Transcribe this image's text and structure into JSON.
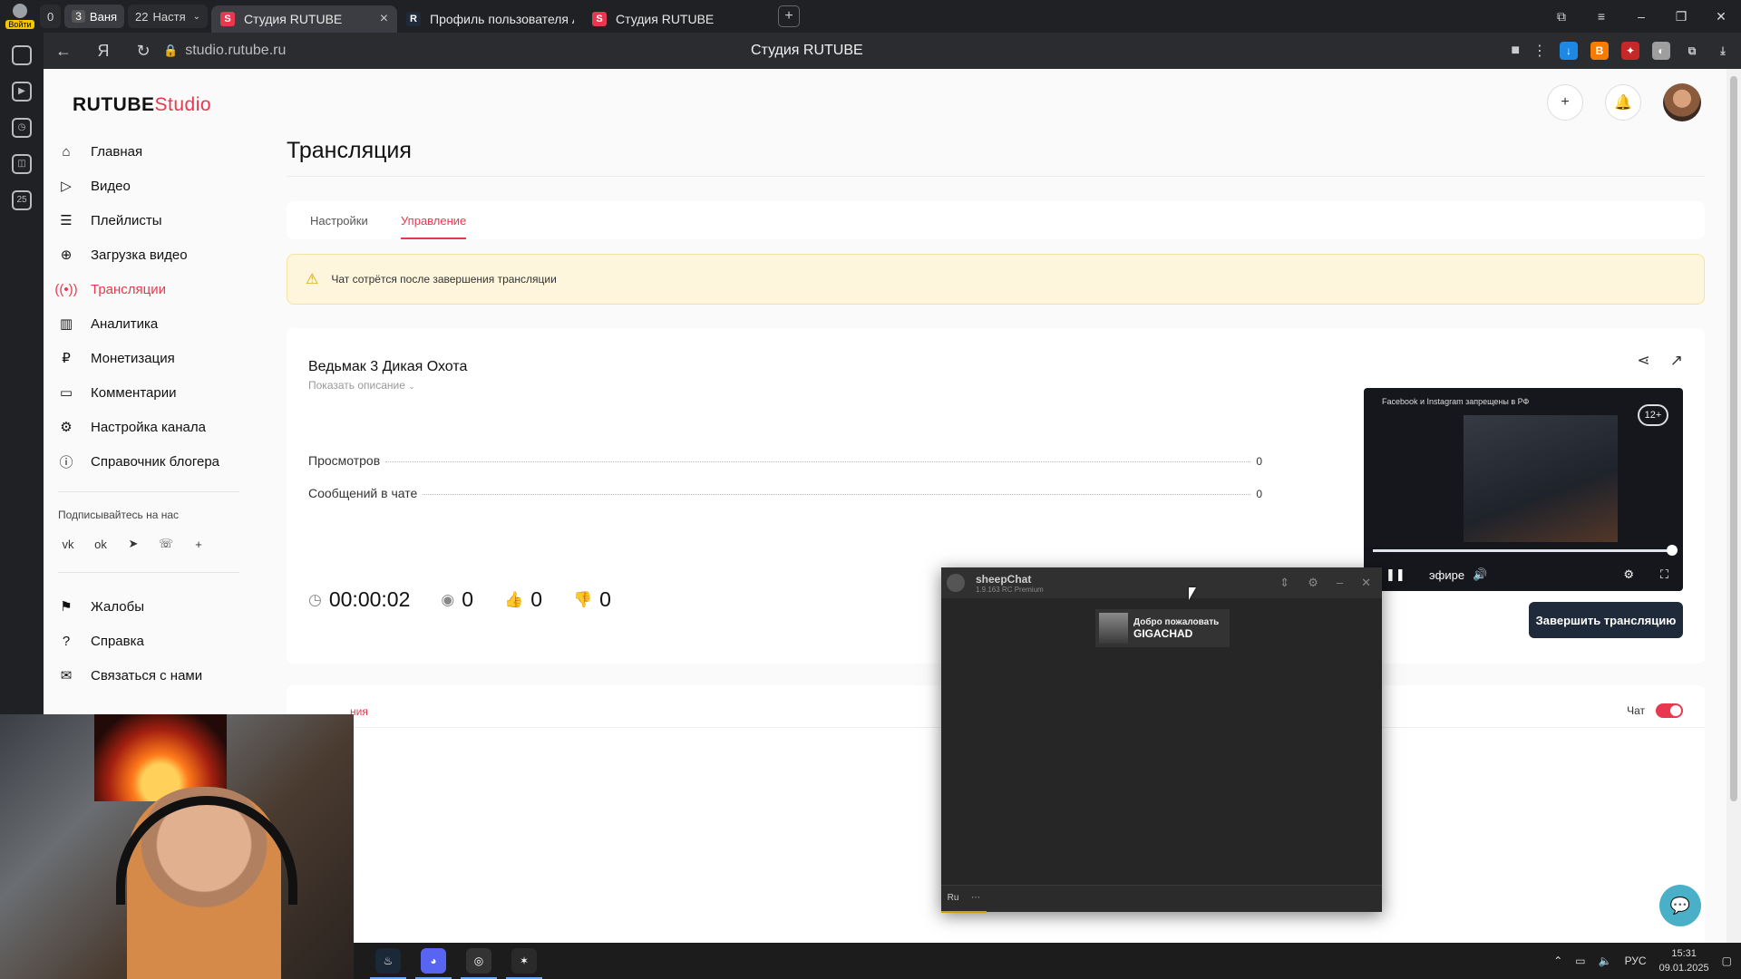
{
  "browser": {
    "login_badge": "Войти",
    "group_count": "0",
    "groups": [
      {
        "num": "3",
        "label": "Ваня"
      },
      {
        "num": "22",
        "label": "Настя"
      }
    ],
    "tabs": [
      {
        "label": "Студия RUTUBE",
        "active": true,
        "fav": "S",
        "fav_color": "#e8384f"
      },
      {
        "label": "Профиль пользователя А",
        "active": false,
        "fav": "R",
        "fav_color": "#1f2a3a"
      },
      {
        "label": "Студия RUTUBE",
        "active": false,
        "fav": "S",
        "fav_color": "#e8384f"
      }
    ],
    "url": "studio.rutube.ru",
    "title": "Студия RUTUBE",
    "rail_badge": "25"
  },
  "logo": {
    "main": "RUTUBE",
    "accent": "Studio"
  },
  "sidebar": {
    "items": [
      {
        "label": "Главная",
        "icon": "home-icon"
      },
      {
        "label": "Видео",
        "icon": "video-icon"
      },
      {
        "label": "Плейлисты",
        "icon": "playlist-icon"
      },
      {
        "label": "Загрузка видео",
        "icon": "upload-icon"
      },
      {
        "label": "Трансляции",
        "icon": "broadcast-icon",
        "active": true
      },
      {
        "label": "Аналитика",
        "icon": "analytics-icon"
      },
      {
        "label": "Монетизация",
        "icon": "monetization-icon"
      },
      {
        "label": "Комментарии",
        "icon": "comments-icon"
      },
      {
        "label": "Настройка канала",
        "icon": "gear-icon"
      },
      {
        "label": "Справочник блогера",
        "icon": "info-icon"
      }
    ],
    "subscribe_label": "Подписывайтесь на нас",
    "socials": [
      "vk",
      "ok",
      "telegram",
      "viber",
      "+"
    ],
    "bottom_items": [
      {
        "label": "Жалобы",
        "icon": "flag-icon"
      },
      {
        "label": "Справка",
        "icon": "help-icon"
      },
      {
        "label": "Связаться с нами",
        "icon": "mail-icon"
      }
    ]
  },
  "page": {
    "title": "Трансляция",
    "tabs": [
      {
        "label": "Настройки",
        "active": false
      },
      {
        "label": "Управление",
        "active": true
      }
    ],
    "warning": "Чат сотрётся после завершения трансляции"
  },
  "stream": {
    "title": "Ведьмак 3 Дикая Охота",
    "show_description": "Показать описание",
    "stats": [
      {
        "label": "Просмотров",
        "value": "0"
      },
      {
        "label": "Сообщений в чате",
        "value": "0"
      }
    ],
    "duration": "00:00:02",
    "viewers": "0",
    "likes": "0",
    "dislikes": "0",
    "end_button": "Завершить трансляцию",
    "preview": {
      "banner": "Facebook и Instagram запрещены в РФ",
      "age": "12+",
      "live_label": "эфире",
      "progress": 1.0
    }
  },
  "chat_section": {
    "tab_fragment": "ния",
    "toggle_label": "Чат",
    "toggle_on": true
  },
  "sheepchat": {
    "name": "sheepChat",
    "version": "1.9.163 RC Premium",
    "welcome_line1": "Добро пожаловать",
    "welcome_line2": "GIGACHAD",
    "lang": "Ru"
  },
  "taskbar": {
    "lang": "РУС",
    "time": "15:31",
    "date": "09.01.2025"
  }
}
